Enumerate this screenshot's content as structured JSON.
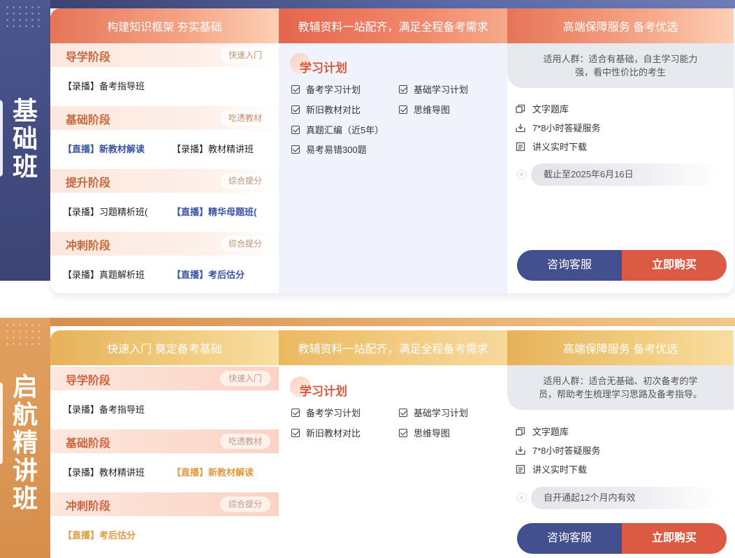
{
  "sections": [
    {
      "title": "基础班",
      "col_headers": [
        "构建知识框架 夯实基础",
        "教辅资料一站配齐，满足全程备考需求",
        "高端保障服务 备考优选"
      ],
      "stages": [
        {
          "name": "导学阶段",
          "tag": "快速入门",
          "courses": [
            {
              "text": "【录播】备考指导班",
              "type": "rec"
            }
          ]
        },
        {
          "name": "基础阶段",
          "tag": "吃透教材",
          "courses": [
            {
              "text": "【直播】新教材解读",
              "type": "live"
            },
            {
              "text": "【录播】教材精讲班",
              "type": "rec"
            }
          ]
        },
        {
          "name": "提升阶段",
          "tag": "综合提分",
          "courses": [
            {
              "text": "【录播】习题精析班(",
              "type": "rec"
            },
            {
              "text": "【直播】精华母题班(",
              "type": "live"
            }
          ]
        },
        {
          "name": "冲刺阶段",
          "tag": "综合提分",
          "courses": [
            {
              "text": "【录播】真题解析班",
              "type": "rec"
            },
            {
              "text": "【直播】考后估分",
              "type": "live"
            }
          ]
        }
      ],
      "plan_title": "学习计划",
      "plan_items": [
        "备考学习计划",
        "基础学习计划",
        "新旧教材对比",
        "思维导图",
        "真题汇编（近5年）",
        "易考易错300题"
      ],
      "target": "适用人群：适合有基础，自主学习能力强，看中性价比的考生",
      "services": [
        "文字题库",
        "7*8小时答疑服务",
        "讲义实时下载"
      ],
      "expiry": "截止至2025年6月16日",
      "consult_label": "咨询客服",
      "buy_label": "立即购买"
    },
    {
      "title": "启航精讲班",
      "col_headers": [
        "快速入门 奠定备考基础",
        "教辅资料一站配齐，满足全程备考需求",
        "高端保障服务 备考优选"
      ],
      "stages": [
        {
          "name": "导学阶段",
          "tag": "快速入门",
          "courses": [
            {
              "text": "【录播】备考指导班",
              "type": "rec"
            }
          ]
        },
        {
          "name": "基础阶段",
          "tag": "吃透教材",
          "courses": [
            {
              "text": "【录播】教材精讲班",
              "type": "rec"
            },
            {
              "text": "【直播】新教材解读",
              "type": "live"
            }
          ]
        },
        {
          "name": "冲刺阶段",
          "tag": "综合提分",
          "courses": [
            {
              "text": "【直播】考后估分",
              "type": "live"
            }
          ]
        }
      ],
      "plan_title": "学习计划",
      "plan_items": [
        "备考学习计划",
        "基础学习计划",
        "新旧教材对比",
        "思维导图"
      ],
      "target": "适用人群：适合无基础、初次备考的学员，帮助考生梳理学习思路及备考指导。",
      "services": [
        "文字题库",
        "7*8小时答疑服务",
        "讲义实时下载"
      ],
      "expiry": "自开通起12个月内有效",
      "consult_label": "咨询客服",
      "buy_label": "立即购买"
    }
  ],
  "icons": {
    "service_icons": [
      "question-bank-icon",
      "download-answer-icon",
      "handout-icon"
    ],
    "check": "checkbox-checked-icon"
  },
  "colors": {
    "navy": "#3b4373",
    "orange": "#d68e4c",
    "buy": "#dc5a43",
    "consult": "#43508f"
  }
}
